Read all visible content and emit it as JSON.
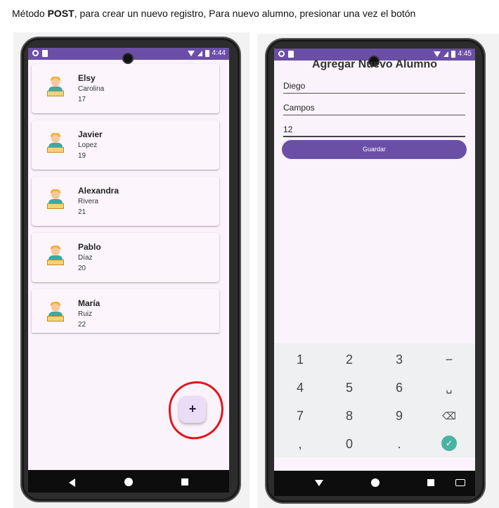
{
  "caption": {
    "prefix": "Método ",
    "method": "POST",
    "suffix": ", para crear un nuevo registro, Para nuevo alumno, presionar una vez el botón"
  },
  "left_phone": {
    "status_time": "4:44",
    "students": [
      {
        "name": "Elsy",
        "last_name": "Carolina",
        "age": "17"
      },
      {
        "name": "Javier",
        "last_name": "Lopez",
        "age": "19"
      },
      {
        "name": "Alexandra",
        "last_name": "Rivera",
        "age": "21"
      },
      {
        "name": "Pablo",
        "last_name": "Díaz",
        "age": "20"
      },
      {
        "name": "María",
        "last_name": "Ruiz",
        "age": "22"
      }
    ],
    "fab_label": "+"
  },
  "right_phone": {
    "status_time": "4:45",
    "title": "Agregar Nuevo Alumno",
    "fields": {
      "name": "Diego",
      "last_name": "Campos",
      "age": "12"
    },
    "save_label": "Guardar",
    "keys": [
      "1",
      "2",
      "3",
      "−",
      "4",
      "5",
      "6",
      "␣",
      "7",
      "8",
      "9",
      "⌫",
      ",",
      "0",
      "."
    ],
    "done_key": "✓"
  },
  "colors": {
    "primary": "#6b4fa6",
    "annotation": "#e0161b",
    "done_key": "#4ab3a2"
  },
  "icons": [
    "avatar-icon",
    "wifi-icon",
    "signal-icon",
    "battery-icon",
    "back-icon",
    "home-icon",
    "recents-icon",
    "keyboard-icon",
    "backspace-icon",
    "check-icon"
  ]
}
